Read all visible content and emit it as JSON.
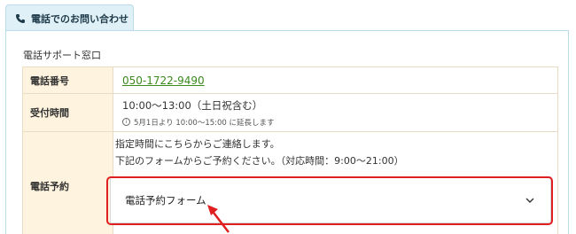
{
  "tab": {
    "label": "電話でのお問い合わせ",
    "icon": "phone-icon"
  },
  "panel": {
    "title": "電話サポート窓口"
  },
  "rows": {
    "phone": {
      "label": "電話番号",
      "number": "050-1722-9490"
    },
    "hours": {
      "label": "受付時間",
      "main": "10:00〜13:00（土日祝含む）",
      "note": "5月1日より 10:00〜15:00 に延長します",
      "note_icon": "info-icon"
    },
    "reserve": {
      "label": "電話予約",
      "line1": "指定時間にこちらからご連絡します。",
      "line2": "下記のフォームからご予約ください。（対応時間：9:00〜21:00）",
      "form_label": "電話予約フォーム",
      "form_icon": "chevron-down-icon"
    }
  },
  "colors": {
    "link": "#3a8a1d",
    "label_bg": "#fdf3de",
    "highlight": "#e02020",
    "tab_bg": "#dff0f7"
  }
}
